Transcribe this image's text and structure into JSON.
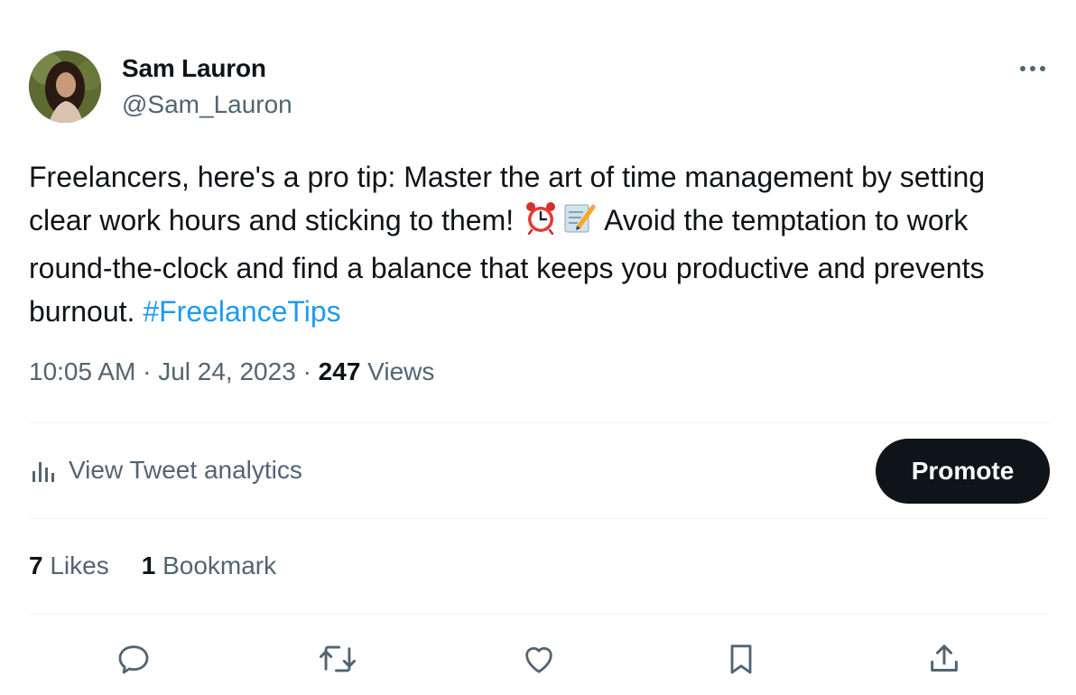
{
  "author": {
    "display_name": "Sam Lauron",
    "handle": "@Sam_Lauron"
  },
  "tweet": {
    "text_part1": "Freelancers, here's a pro tip: Master the art of time management by setting clear work hours and sticking to them! ",
    "emoji1": "alarm-clock-emoji",
    "emoji2": "memo-emoji",
    "text_part2": " Avoid the temptation to work round-the-clock and find a balance that keeps you productive and prevents burnout. ",
    "hashtag": "#FreelanceTips"
  },
  "meta": {
    "time": "10:05 AM",
    "separator": "·",
    "date": "Jul 24, 2023",
    "views_count": "247",
    "views_label": "Views"
  },
  "analytics": {
    "label": "View Tweet analytics",
    "icon": "analytics-icon"
  },
  "promote_label": "Promote",
  "stats": {
    "likes_count": "7",
    "likes_label": "Likes",
    "bookmarks_count": "1",
    "bookmarks_label": "Bookmark"
  },
  "actions": [
    "reply-icon",
    "retweet-icon",
    "like-icon",
    "bookmark-icon",
    "share-icon"
  ],
  "colors": {
    "text": "#0f1419",
    "secondary": "#536471",
    "link": "#1d9bf0",
    "divider": "#eff3f4",
    "button_bg": "#0f1419"
  }
}
